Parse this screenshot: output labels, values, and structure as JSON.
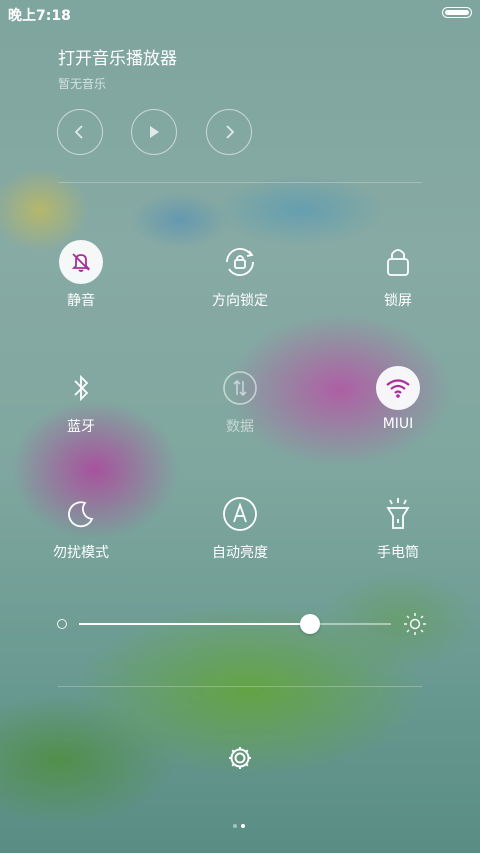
{
  "status_bar": {
    "time": "晚上7:18",
    "battery_level": 1.0
  },
  "music": {
    "title": "打开音乐播放器",
    "subtitle": "暂无音乐"
  },
  "media_controls": {
    "prev_icon": "chevron-left-icon",
    "play_icon": "play-icon",
    "next_icon": "chevron-right-icon"
  },
  "toggles": [
    {
      "label": "静音",
      "icon": "bell-slash-icon",
      "on": true
    },
    {
      "label": "方向锁定",
      "icon": "rotation-lock-icon",
      "on": false
    },
    {
      "label": "锁屏",
      "icon": "lock-icon",
      "on": false
    },
    {
      "label": "蓝牙",
      "icon": "bluetooth-icon",
      "on": false
    },
    {
      "label": "数据",
      "icon": "data-arrows-icon",
      "on": false
    },
    {
      "label": "MIUI",
      "icon": "wifi-icon",
      "on": true
    },
    {
      "label": "勿扰模式",
      "icon": "moon-icon",
      "on": false
    },
    {
      "label": "自动亮度",
      "icon": "auto-brightness-icon",
      "on": false
    },
    {
      "label": "手电筒",
      "icon": "flashlight-icon",
      "on": false
    }
  ],
  "brightness": {
    "value": 0.74
  },
  "pager": {
    "pages": 2,
    "current": 2
  },
  "colors": {
    "active_icon": "#a62f9b",
    "inactive_icon": "#ffffff"
  }
}
